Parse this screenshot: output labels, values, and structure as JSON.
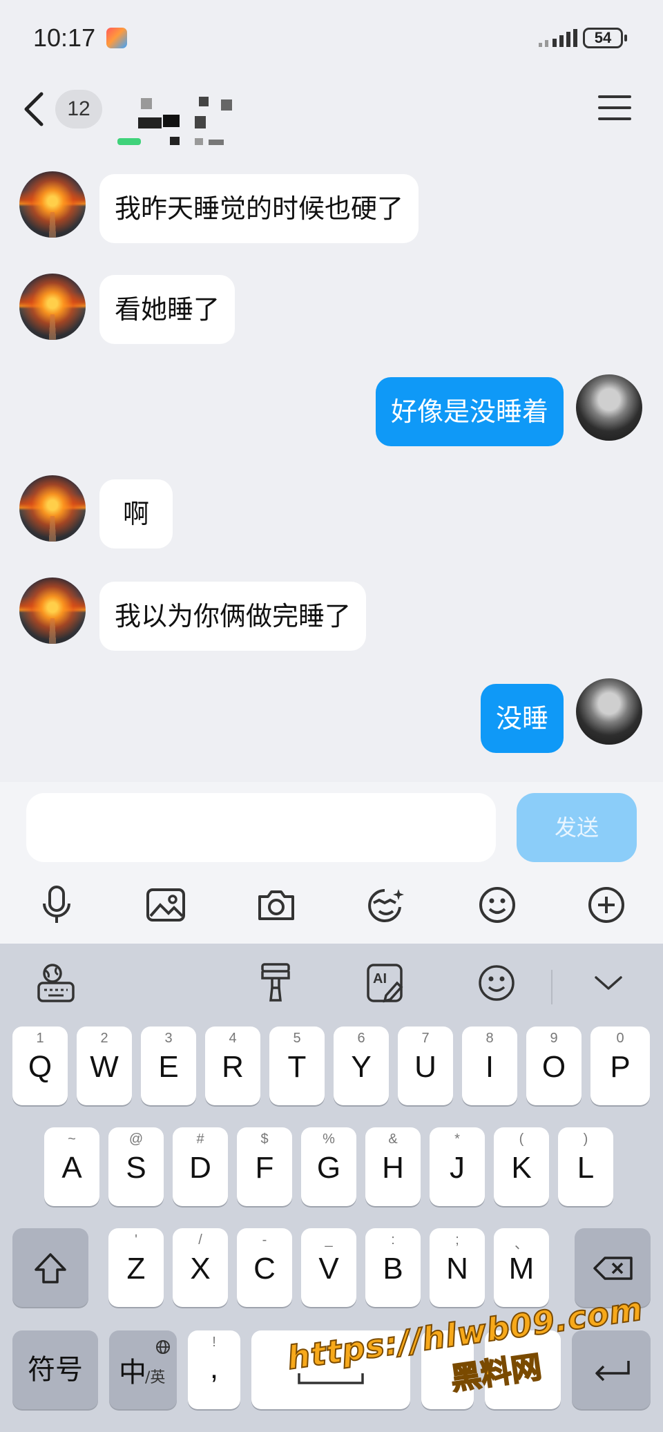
{
  "status_bar": {
    "time": "10:17",
    "battery": "54"
  },
  "header": {
    "unread_count": "12"
  },
  "messages": [
    {
      "side": "in",
      "avatar": "sunset-road-avatar",
      "text": "我昨天睡觉的时候也硬了"
    },
    {
      "side": "in",
      "avatar": "sunset-road-avatar",
      "text": "看她睡了"
    },
    {
      "side": "out",
      "avatar": "man-portrait-avatar",
      "text": "好像是没睡着"
    },
    {
      "side": "in",
      "avatar": "sunset-road-avatar",
      "text": "啊"
    },
    {
      "side": "in",
      "avatar": "sunset-road-avatar",
      "text": "我以为你俩做完睡了"
    },
    {
      "side": "out",
      "avatar": "man-portrait-avatar",
      "text": "没睡"
    }
  ],
  "composer": {
    "input_value": "",
    "send_label": "发送"
  },
  "tools": [
    "microphone-icon",
    "image-icon",
    "camera-icon",
    "sticker-face-icon",
    "emoji-icon",
    "plus-icon"
  ],
  "keyboard": {
    "toolbar": [
      "globe-keyboard-icon",
      "brush-icon",
      "ai-write-icon",
      "emoji-icon",
      "chevron-down-icon"
    ],
    "row1": [
      {
        "hint": "1",
        "key": "Q"
      },
      {
        "hint": "2",
        "key": "W"
      },
      {
        "hint": "3",
        "key": "E"
      },
      {
        "hint": "4",
        "key": "R"
      },
      {
        "hint": "5",
        "key": "T"
      },
      {
        "hint": "6",
        "key": "Y"
      },
      {
        "hint": "7",
        "key": "U"
      },
      {
        "hint": "8",
        "key": "I"
      },
      {
        "hint": "9",
        "key": "O"
      },
      {
        "hint": "0",
        "key": "P"
      }
    ],
    "row2": [
      {
        "hint": "~",
        "key": "A"
      },
      {
        "hint": "@",
        "key": "S"
      },
      {
        "hint": "#",
        "key": "D"
      },
      {
        "hint": "$",
        "key": "F"
      },
      {
        "hint": "%",
        "key": "G"
      },
      {
        "hint": "&",
        "key": "H"
      },
      {
        "hint": "*",
        "key": "J"
      },
      {
        "hint": "(",
        "key": "K"
      },
      {
        "hint": ")",
        "key": "L"
      }
    ],
    "row3": [
      {
        "hint": "'",
        "key": "Z"
      },
      {
        "hint": "/",
        "key": "X"
      },
      {
        "hint": "-",
        "key": "C"
      },
      {
        "hint": "_",
        "key": "V"
      },
      {
        "hint": ":",
        "key": "B"
      },
      {
        "hint": ";",
        "key": "N"
      },
      {
        "hint": "、",
        "key": "M"
      }
    ],
    "symbols_label": "符号",
    "lang_label": "中",
    "lang_sub_label": "/英",
    "comma_hint": "!",
    "comma_key": ","
  },
  "watermark": {
    "url": "https://hlwb09.com",
    "name": "黑料网"
  }
}
